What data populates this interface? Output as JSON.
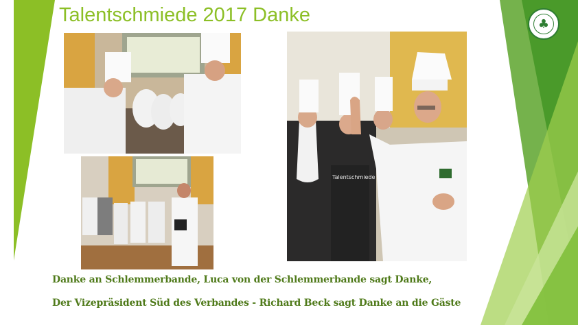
{
  "slide": {
    "title": "Talentschmiede 2017 Danke",
    "captions": [
      "Danke an Schlemmerbande, Luca von der Schlemmerbande sagt Danke,",
      "Der Vizepräsident Süd des Verbandes - Richard Beck sagt Danke an die Gäste"
    ],
    "logo_icon": "clover-seal-icon",
    "photo_icons": [
      "chef-group-photo-icon",
      "chef-group-photo-icon",
      "chef-group-photo-icon"
    ],
    "apron_text": "Talentschmiede",
    "accent_color": "#8cbf26",
    "caption_color": "#4f7a1a"
  }
}
